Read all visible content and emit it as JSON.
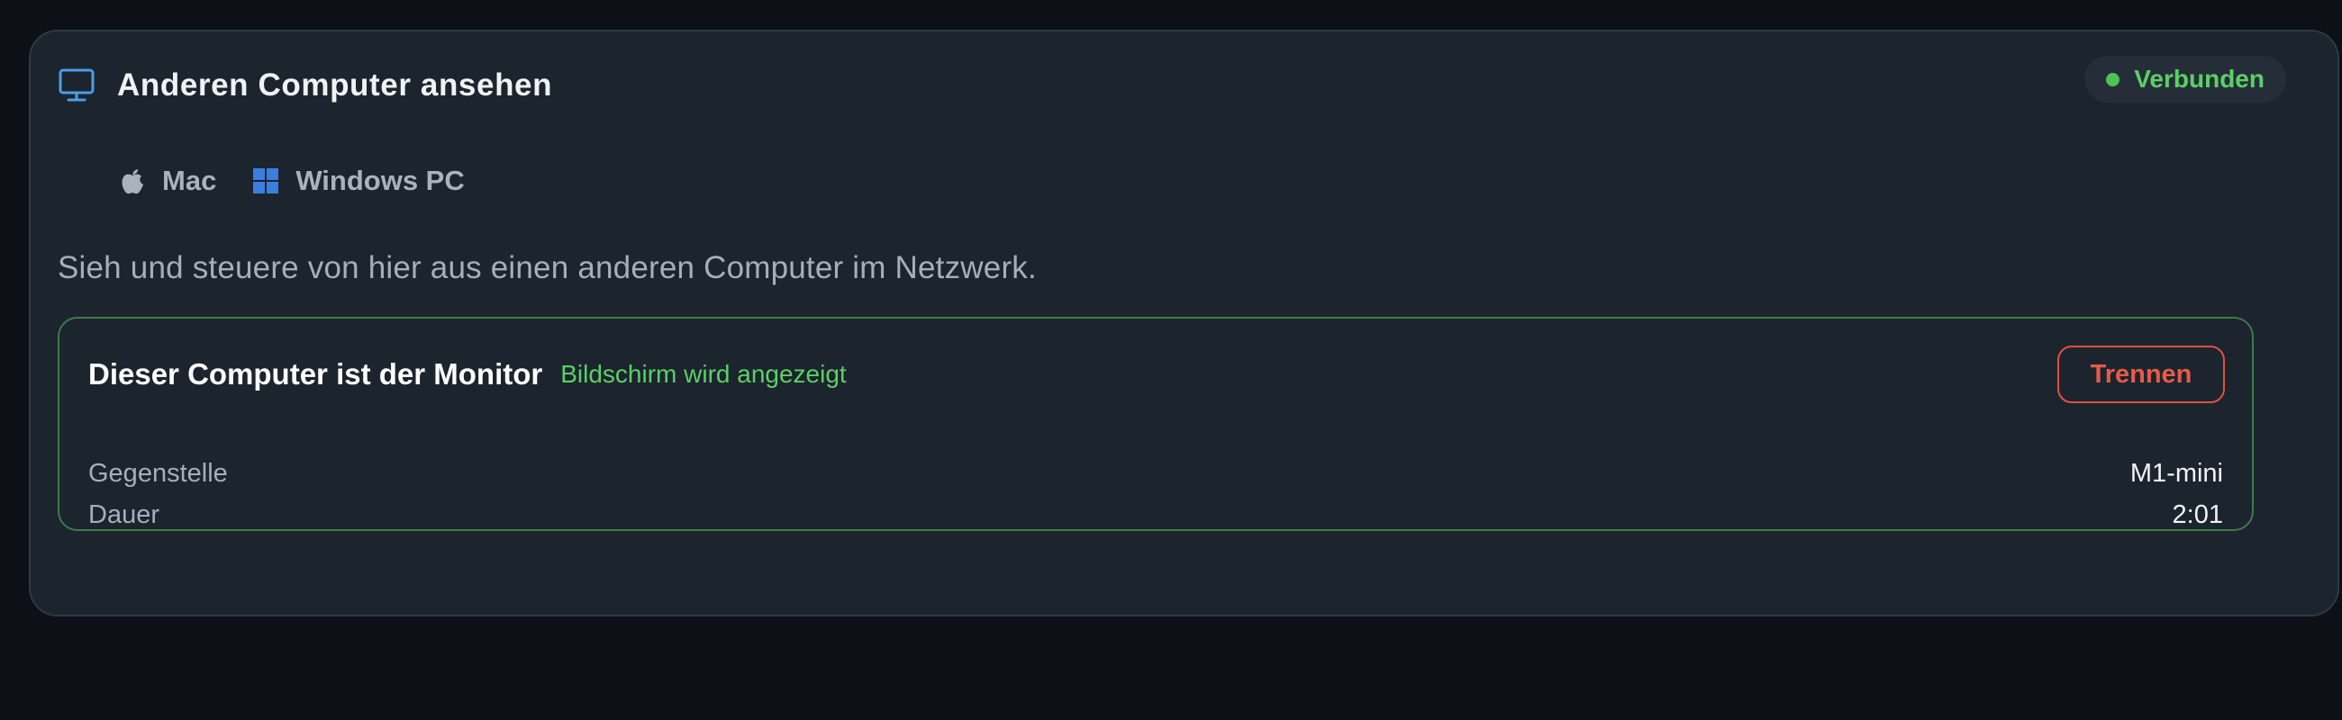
{
  "panel": {
    "title": "Anderen Computer ansehen",
    "title_icon": "monitor-icon",
    "status": {
      "label": "Verbunden",
      "color": "#5ccf65"
    },
    "platforms": [
      {
        "label": "Mac",
        "icon": "apple-icon"
      },
      {
        "label": "Windows PC",
        "icon": "windows-icon"
      }
    ],
    "description": "Sieh und steuere von hier aus einen anderen Computer im Netzwerk."
  },
  "session": {
    "title": "Dieser Computer ist der Monitor",
    "subtitle": "Bildschirm wird angezeigt",
    "disconnect_label": "Trennen",
    "rows": [
      {
        "label": "Gegenstelle",
        "value": "M1-mini"
      },
      {
        "label": "Dauer",
        "value": "2:01"
      }
    ]
  },
  "colors": {
    "accent_blue": "#4a9ee8",
    "success": "#5ccf65",
    "danger": "#e85a47",
    "windows_blue": "#3a7ee0"
  }
}
